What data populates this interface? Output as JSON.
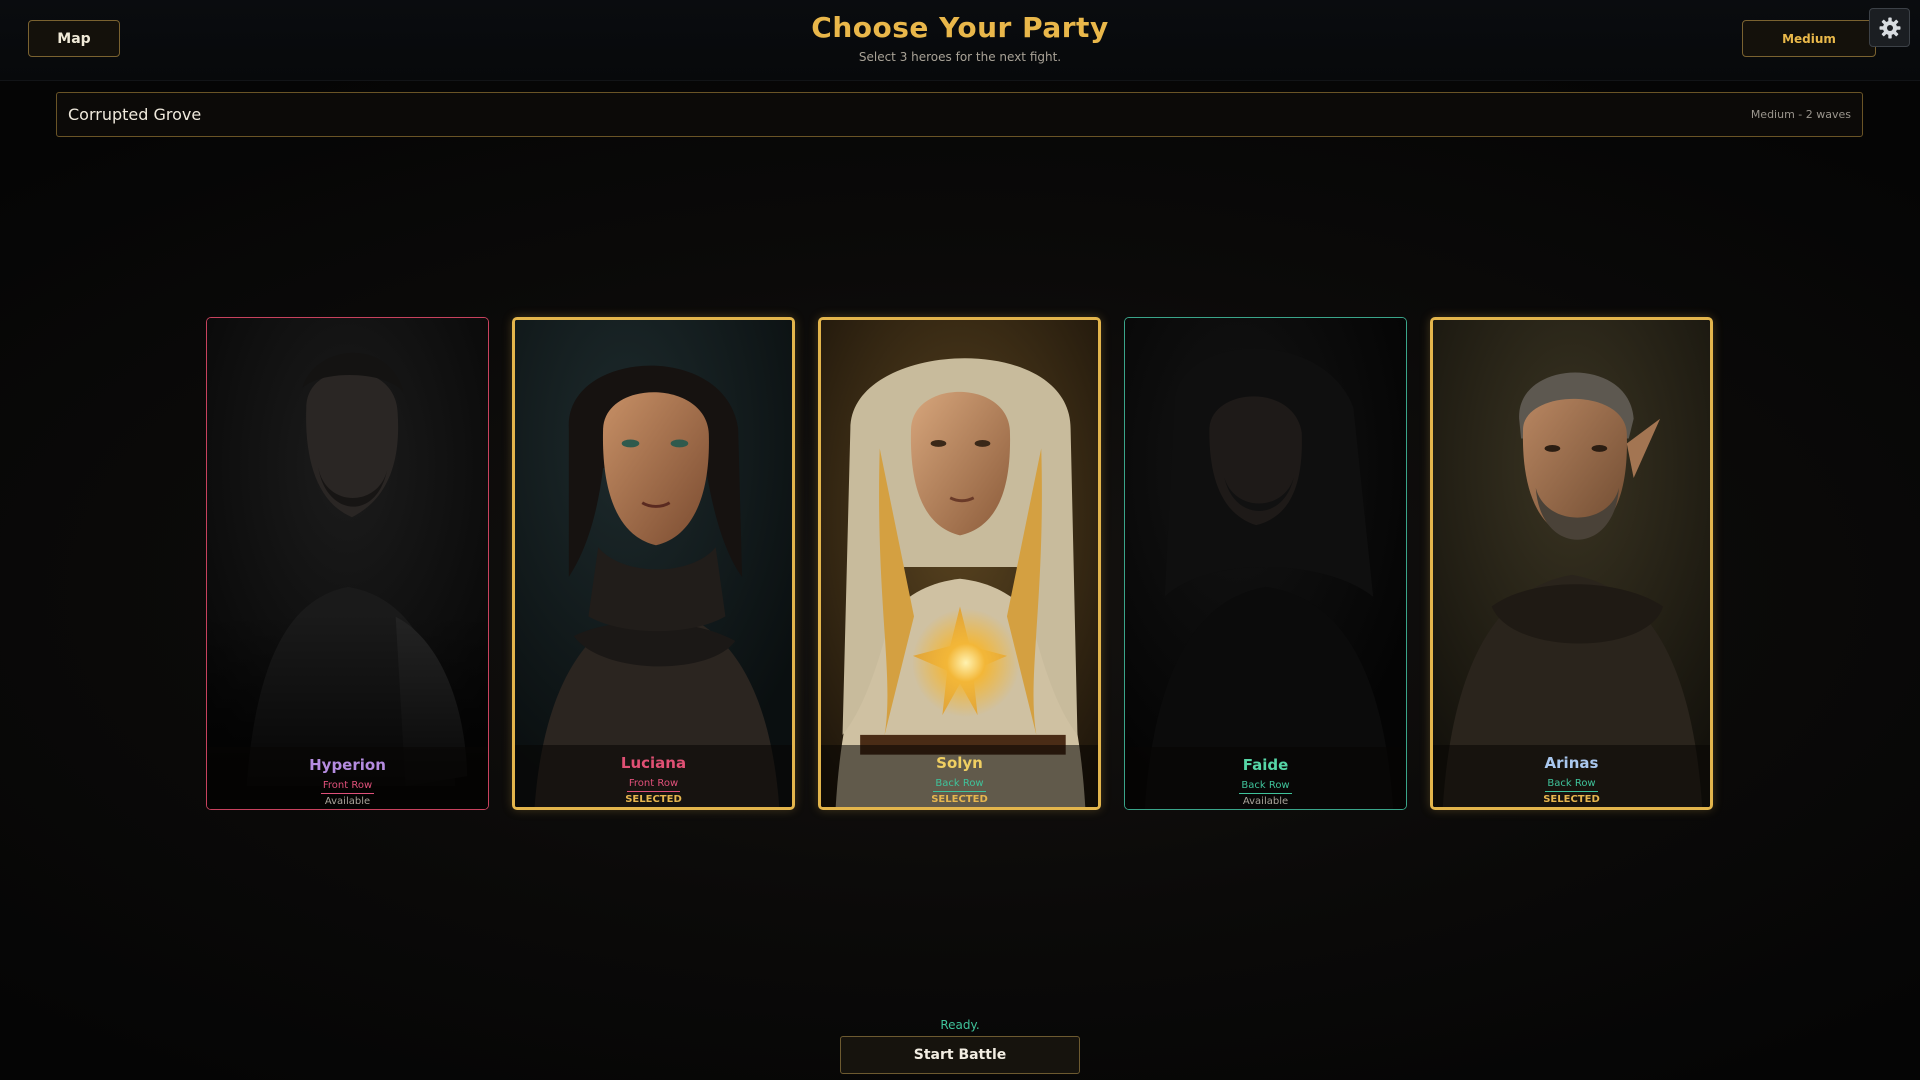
{
  "header": {
    "title": "Choose Your Party",
    "subtitle": "Select 3 heroes for the next fight.",
    "map_button": "Map",
    "difficulty_button": "Medium",
    "settings_icon": "gear-icon"
  },
  "stage": {
    "name": "Corrupted Grove",
    "info": "Medium - 2 waves"
  },
  "heroes": [
    {
      "name": "Hyperion",
      "row": "Front Row",
      "status": "Available",
      "selected": false,
      "name_color": "#b58ce0",
      "row_color": "#e0507a",
      "border_color": "#c8425e"
    },
    {
      "name": "Luciana",
      "row": "Front Row",
      "status": "SELECTED",
      "selected": true,
      "name_color": "#e05074",
      "row_color": "#e0507a",
      "border_color": "#e3b54c"
    },
    {
      "name": "Solyn",
      "row": "Back Row",
      "status": "SELECTED",
      "selected": true,
      "name_color": "#f0cf62",
      "row_color": "#3fc39b",
      "border_color": "#e3b54c"
    },
    {
      "name": "Faide",
      "row": "Back Row",
      "status": "Available",
      "selected": false,
      "name_color": "#56d6a6",
      "row_color": "#3fc39b",
      "border_color": "#3aa58a"
    },
    {
      "name": "Arinas",
      "row": "Back Row",
      "status": "SELECTED",
      "selected": true,
      "name_color": "#a9c7ee",
      "row_color": "#3fc39b",
      "border_color": "#e3b54c"
    }
  ],
  "footer": {
    "status": "Ready.",
    "start_button": "Start Battle"
  },
  "colors": {
    "accent_gold": "#e9b74a",
    "ready_green": "#3fc39b"
  }
}
